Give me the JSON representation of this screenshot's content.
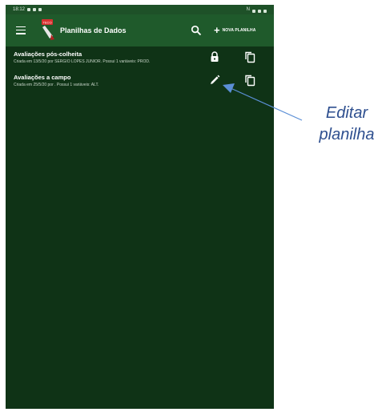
{
  "status_bar": {
    "time": "18:12",
    "right_text": "N"
  },
  "app_bar": {
    "title": "Planilhas de Dados",
    "new_sheet_label": "NOVA PLANILHA",
    "logo_text": "TECO"
  },
  "sheets": [
    {
      "title": "Avaliações pós-colheita",
      "subtitle": "Criada em 13/5/20 por SERGIO LOPES JUNIOR. Possui 1 variáveis: PROD.",
      "status_icon": "lock-icon",
      "copy_icon": "copy-icon"
    },
    {
      "title": "Avaliações a campo",
      "subtitle": "Criada em 25/5/20 por . Possui 1 variáveis: ALT.",
      "status_icon": "edit-icon",
      "copy_icon": "copy-icon"
    }
  ],
  "annotation": {
    "line1": "Editar",
    "line2": "planilha"
  },
  "colors": {
    "background": "#0f3316",
    "app_bar": "#1f5a2b",
    "status_bar": "#1e5128",
    "annotation": "#2e4f8f",
    "arrow": "#5b8fd6"
  }
}
